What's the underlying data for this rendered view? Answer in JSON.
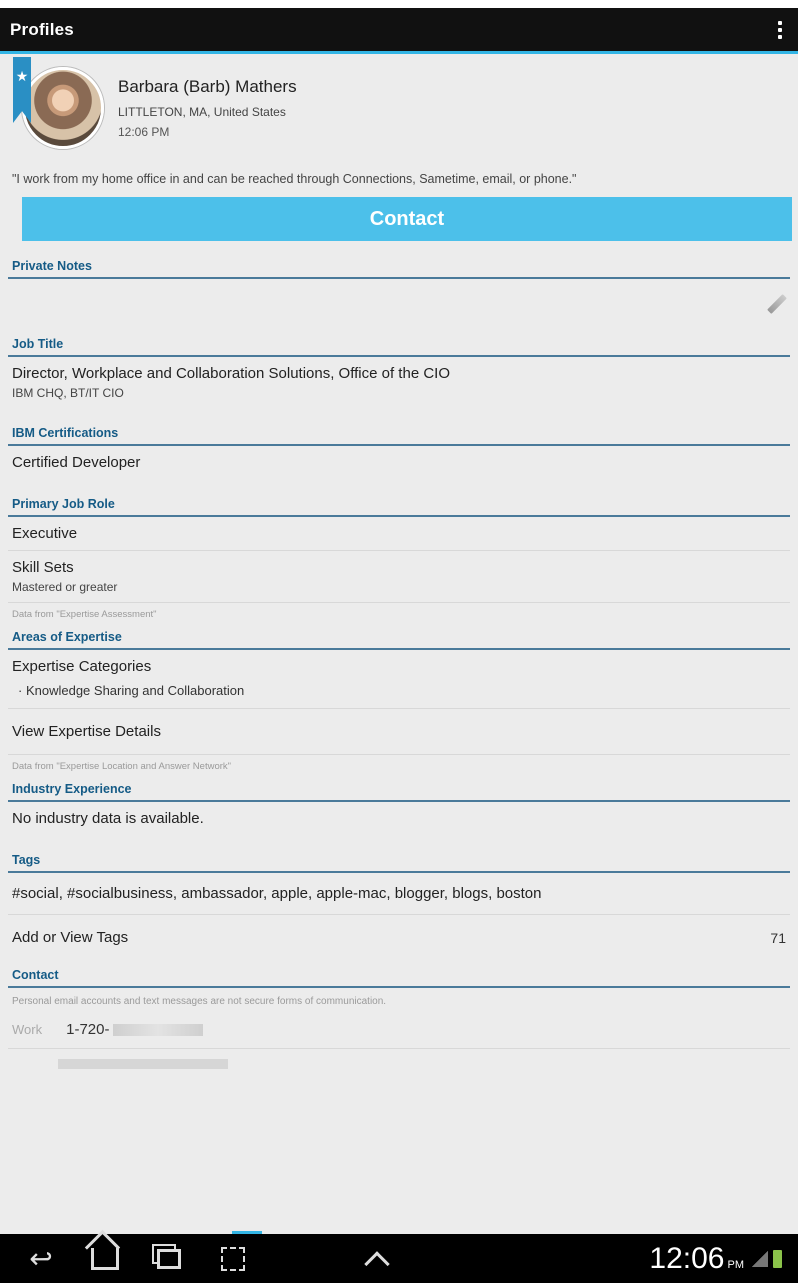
{
  "app": {
    "title": "Profiles"
  },
  "profile": {
    "name": "Barbara  (Barb) Mathers",
    "location": "LITTLETON, MA, United States",
    "time": "12:06 PM",
    "quote": "\"I work from my home office in and can be reached through Connections, Sametime, email, or phone.\"",
    "contact_label": "Contact"
  },
  "sections": {
    "private_notes": {
      "header": "Private Notes"
    },
    "job_title": {
      "header": "Job Title",
      "title": "Director, Workplace and Collaboration Solutions, Office of the CIO",
      "dept": "IBM CHQ, BT/IT CIO"
    },
    "certifications": {
      "header": "IBM Certifications",
      "value": "Certified Developer"
    },
    "job_role": {
      "header": "Primary Job Role",
      "role": "Executive",
      "skill_label": "Skill Sets",
      "skill_value": "Mastered or greater",
      "source": "Data from \"Expertise Assessment\""
    },
    "expertise": {
      "header": "Areas of Expertise",
      "categories_label": "Expertise Categories",
      "category_item": "Knowledge Sharing and Collaboration",
      "details_label": "View Expertise Details",
      "source": "Data from \"Expertise Location and Answer Network\""
    },
    "industry": {
      "header": "Industry Experience",
      "value": "No industry data is available."
    },
    "tags": {
      "header": "Tags",
      "list": "#social, #socialbusiness, ambassador, apple, apple-mac, blogger, blogs, boston",
      "add_label": "Add or View Tags",
      "count": "71"
    },
    "contact": {
      "header": "Contact",
      "notice": "Personal email accounts and text messages are not secure forms of communication.",
      "work_label": "Work",
      "work_prefix": "1-720-"
    }
  },
  "statusbar": {
    "time": "12:06",
    "ampm": "PM"
  },
  "icons": {
    "bookmark_star": "★",
    "overflow": "overflow-menu-icon",
    "back": "↩",
    "up": "up-arrow-icon"
  },
  "colors": {
    "accent": "#4cc0ea",
    "header_blue": "#155b86",
    "action_bar": "#111111"
  }
}
